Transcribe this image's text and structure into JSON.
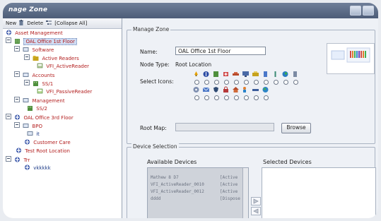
{
  "window": {
    "title": "nage Zone"
  },
  "toolbar": {
    "new_label": "New",
    "delete_label": "Delete",
    "collapse_label": "[Collapse All]"
  },
  "tree": {
    "nodes": [
      {
        "label": "Asset Management"
      },
      {
        "label": "OAL Office 1st Floor"
      },
      {
        "label": "Software"
      },
      {
        "label": "Active Readers"
      },
      {
        "label": "VFI_ActiveReader"
      },
      {
        "label": "Accounts"
      },
      {
        "label": "SS/1"
      },
      {
        "label": "VFI_PassiveReader"
      },
      {
        "label": "Management"
      },
      {
        "label": "SS/2"
      },
      {
        "label": "OAL Office 3rd Floor"
      },
      {
        "label": "BPO"
      },
      {
        "label": "it"
      },
      {
        "label": "Customer Care"
      },
      {
        "label": "Test Root Location"
      },
      {
        "label": "Trr"
      },
      {
        "label": "vkkkkk"
      }
    ]
  },
  "manage_zone": {
    "legend": "Manage Zone",
    "name_label": "Name:",
    "name_value": "OAL Office 1st Floor",
    "node_type_label": "Node Type:",
    "node_type_value": "Root Location",
    "select_icons_label": "Select Icons:",
    "root_map_label": "Root Map:",
    "root_map_value": "",
    "browse_label": "Browse"
  },
  "device_selection": {
    "legend": "Device Selection",
    "available_label": "Available Devices",
    "selected_label": "Selected Devices",
    "available_rows": [
      {
        "name": "Mathew 8 D7",
        "status": "[Active"
      },
      {
        "name": "VFI_ActiveReader_0010",
        "status": "[Active"
      },
      {
        "name": "VFI_ActiveReader_0012",
        "status": "[Active"
      },
      {
        "name": "dddd",
        "status": "[Dispose"
      }
    ]
  }
}
